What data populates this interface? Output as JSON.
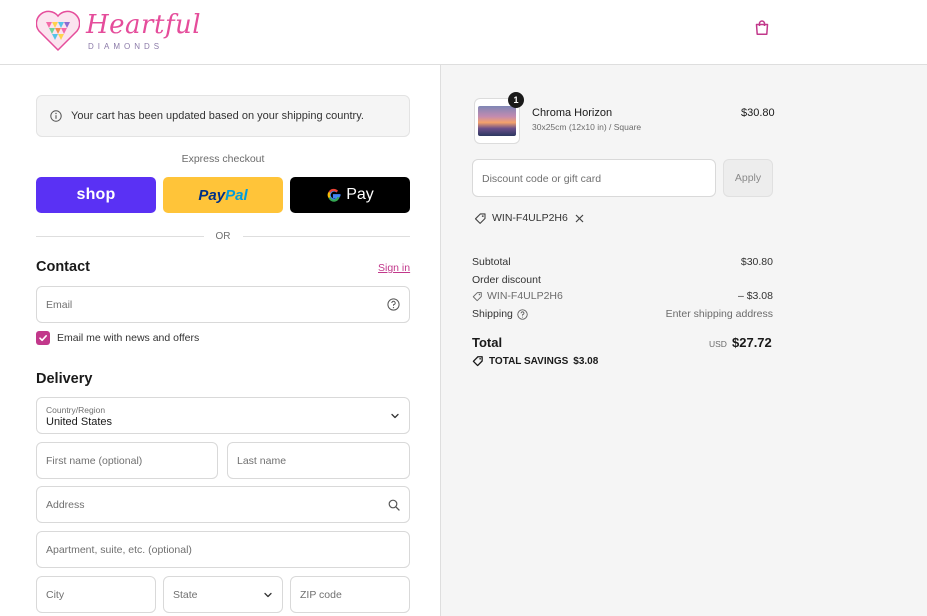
{
  "header": {
    "logo_word": "Heartful",
    "logo_sub": "DIAMONDS"
  },
  "notice": {
    "text": "Your cart has been updated based on your shipping country."
  },
  "express": {
    "label": "Express checkout",
    "shop_label": "shop",
    "paypal_pay": "Pay",
    "paypal_pal": "Pal",
    "gpay_label": "Pay",
    "or_label": "OR"
  },
  "contact": {
    "title": "Contact",
    "signin_label": "Sign in",
    "email_placeholder": "Email",
    "newsletter_label": "Email me with news and offers",
    "newsletter_checked": true
  },
  "delivery": {
    "title": "Delivery",
    "country_label": "Country/Region",
    "country_value": "United States",
    "first_name_placeholder": "First name (optional)",
    "last_name_placeholder": "Last name",
    "address_placeholder": "Address",
    "apartment_placeholder": "Apartment, suite, etc. (optional)",
    "city_placeholder": "City",
    "state_placeholder": "State",
    "zip_placeholder": "ZIP code"
  },
  "cart": {
    "item": {
      "name": "Chroma Horizon",
      "variant": "30x25cm (12x10 in) / Square",
      "price": "$30.80",
      "quantity": "1"
    },
    "discount_placeholder": "Discount code or gift card",
    "apply_label": "Apply",
    "applied_code": "WIN-F4ULP2H6"
  },
  "summary": {
    "subtotal_label": "Subtotal",
    "subtotal_value": "$30.80",
    "order_discount_label": "Order discount",
    "discount_code": "WIN-F4ULP2H6",
    "discount_value": "– $3.08",
    "shipping_label": "Shipping",
    "shipping_value": "Enter shipping address",
    "total_label": "Total",
    "currency": "USD",
    "total_value": "$27.72",
    "savings_label": "TOTAL SAVINGS",
    "savings_value": "$3.08"
  },
  "colors": {
    "accent": "#c2388b",
    "shop": "#5a31f4",
    "paypal": "#ffc439"
  }
}
